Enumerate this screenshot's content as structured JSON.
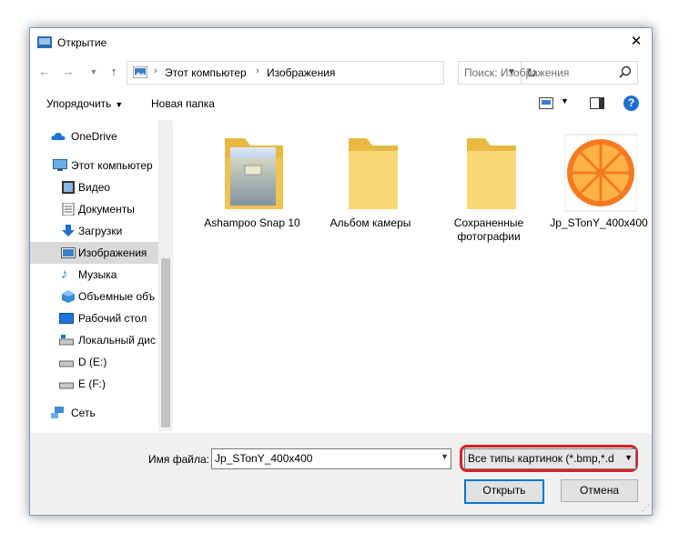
{
  "window": {
    "title": "Открытие"
  },
  "address": {
    "breadcrumb": [
      "Этот компьютер",
      "Изображения"
    ]
  },
  "search": {
    "placeholder": "Поиск: Изображения"
  },
  "toolbar": {
    "organize_label": "Упорядочить",
    "new_folder_label": "Новая папка"
  },
  "sidebar": {
    "items": [
      {
        "label": "OneDrive",
        "icon": "cloud-icon"
      },
      {
        "label": "Этот компьютер",
        "icon": "computer-icon"
      },
      {
        "label": "Видео",
        "icon": "video-folder-icon"
      },
      {
        "label": "Документы",
        "icon": "documents-folder-icon"
      },
      {
        "label": "Загрузки",
        "icon": "downloads-icon"
      },
      {
        "label": "Изображения",
        "icon": "pictures-folder-icon"
      },
      {
        "label": "Музыка",
        "icon": "music-icon"
      },
      {
        "label": "Объемные объ",
        "icon": "3d-objects-icon"
      },
      {
        "label": "Рабочий стол",
        "icon": "desktop-icon"
      },
      {
        "label": "Локальный дис",
        "icon": "local-disk-icon"
      },
      {
        "label": "D (E:)",
        "icon": "drive-icon"
      },
      {
        "label": "E (F:)",
        "icon": "drive-icon"
      },
      {
        "label": "Сеть",
        "icon": "network-icon"
      }
    ],
    "selected": "Изображения"
  },
  "files": [
    {
      "label": "Ashampoo Snap 10",
      "icon": "folder-with-document-icon"
    },
    {
      "label": "Альбом камеры",
      "icon": "folder-icon"
    },
    {
      "label": "Сохраненные фотографии",
      "icon": "folder-icon"
    },
    {
      "label": "Jp_STonY_400x400",
      "icon": "orange-slice-image"
    }
  ],
  "bottom": {
    "filename_label": "Имя файла:",
    "filename_value": "Jp_STonY_400x400",
    "filter_value": "Все типы картинок (*.bmp,*.d",
    "open_label": "Открыть",
    "cancel_label": "Отмена"
  },
  "colors": {
    "accent": "#0078d7",
    "highlight": "#d3232a",
    "folder": "#f8d775"
  }
}
